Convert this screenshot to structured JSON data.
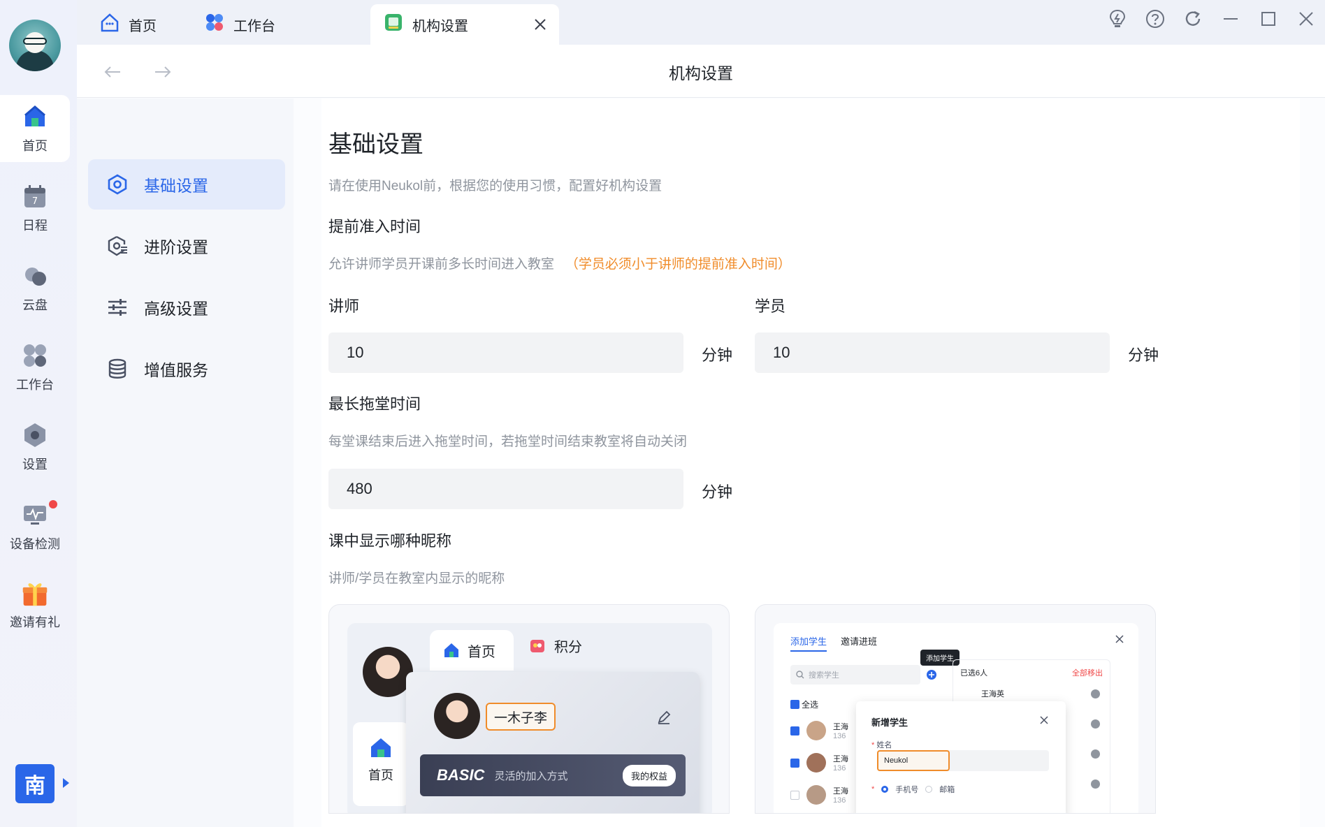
{
  "rail": {
    "items": [
      {
        "label": "首页"
      },
      {
        "label": "日程",
        "day": "7"
      },
      {
        "label": "云盘"
      },
      {
        "label": "工作台"
      },
      {
        "label": "设置"
      },
      {
        "label": "设备检测"
      },
      {
        "label": "邀请有礼"
      }
    ],
    "org_initial": "南"
  },
  "tabs": [
    {
      "label": "首页"
    },
    {
      "label": "工作台"
    },
    {
      "label": "机构设置"
    }
  ],
  "navbar": {
    "title": "机构设置"
  },
  "menu": [
    {
      "label": "基础设置"
    },
    {
      "label": "进阶设置"
    },
    {
      "label": "高级设置"
    },
    {
      "label": "增值服务"
    }
  ],
  "content": {
    "title": "基础设置",
    "intro": "请在使用Neukol前，根据您的使用习惯，配置好机构设置",
    "entry": {
      "title": "提前准入时间",
      "desc": "允许讲师学员开课前多长时间进入教室",
      "warning": "（学员必须小于讲师的提前准入时间）",
      "teacher_label": "讲师",
      "teacher_value": "10",
      "student_label": "学员",
      "student_value": "10",
      "unit": "分钟"
    },
    "overtime": {
      "title": "最长拖堂时间",
      "desc": "每堂课结束后进入拖堂时间，若拖堂时间结束教室将自动关闭",
      "value": "480",
      "unit": "分钟"
    },
    "nickname": {
      "title": "课中显示哪种昵称",
      "desc": "讲师/学员在教室内显示的昵称"
    }
  },
  "preview_left": {
    "tab_home": "首页",
    "tab_points": "积分",
    "side_home": "首页",
    "name": "一木子李",
    "basic": "BASIC",
    "basic_desc": "灵活的加入方式",
    "benefit": "我的权益"
  },
  "preview_right": {
    "tab_add": "添加学生",
    "tab_invite": "邀请进班",
    "tooltip": "添加学生",
    "search_placeholder": "搜索学生",
    "select_all": "全选",
    "selected": "已选6人",
    "remove_all": "全部移出",
    "selected_name": "王海英",
    "rows": [
      {
        "name": "王海",
        "phone": "136"
      },
      {
        "name": "王海",
        "phone": "136"
      },
      {
        "name": "王海",
        "phone": "136"
      }
    ],
    "dialog_title": "新增学生",
    "name_label": "姓名",
    "name_value": "Neukol",
    "opt_phone": "手机号",
    "opt_email": "邮箱"
  },
  "colors": {
    "accent": "#2a66e8",
    "warning": "#f08c2a",
    "badge": "#f04848"
  }
}
